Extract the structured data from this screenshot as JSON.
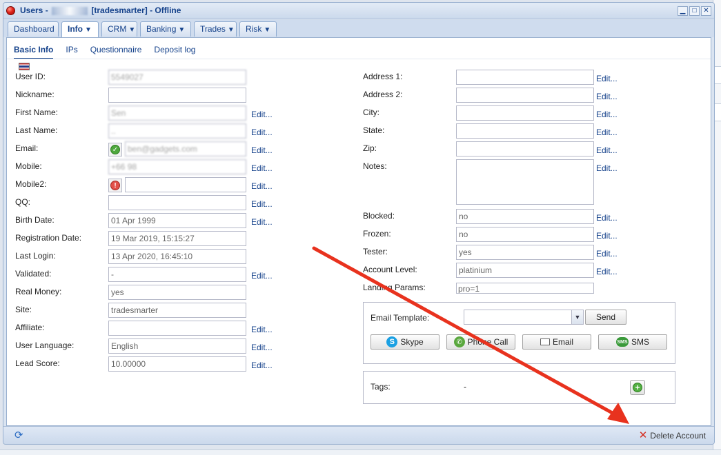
{
  "window": {
    "title_prefix": "Users - ",
    "title_suffix": "[tradesmarter] - Offline",
    "controls": [
      "minimize",
      "maximize",
      "close"
    ]
  },
  "main_tabs": [
    {
      "label": "Dashboard",
      "dropdown": false,
      "active": false
    },
    {
      "label": "Info",
      "dropdown": true,
      "active": true
    },
    {
      "label": "CRM",
      "dropdown": true,
      "active": false
    },
    {
      "label": "Banking",
      "dropdown": true,
      "active": false
    },
    {
      "label": "Trades",
      "dropdown": true,
      "active": false
    },
    {
      "label": "Risk",
      "dropdown": true,
      "active": false
    }
  ],
  "sub_tabs": [
    "Basic Info",
    "IPs",
    "Questionnaire",
    "Deposit log"
  ],
  "edit_label": "Edit...",
  "left_fields": [
    {
      "label": "User ID:",
      "value": "5549027",
      "obscured": true,
      "edit": false
    },
    {
      "label": "Nickname:",
      "value": "",
      "edit": false
    },
    {
      "label": "First Name:",
      "value": "Sen",
      "obscured": true,
      "edit": true
    },
    {
      "label": "Last Name:",
      "value": "..",
      "obscured": true,
      "edit": true
    },
    {
      "label": "Email:",
      "value": "ben@gadgets.com",
      "obscured": true,
      "edit": true,
      "status": "verified"
    },
    {
      "label": "Mobile:",
      "value": "+66 98",
      "obscured": true,
      "edit": true
    },
    {
      "label": "Mobile2:",
      "value": "",
      "edit": true,
      "status": "unverified"
    },
    {
      "label": "QQ:",
      "value": "",
      "edit": true
    },
    {
      "label": "Birth Date:",
      "value": "01 Apr 1999",
      "edit": true
    },
    {
      "label": "Registration Date:",
      "value": "19 Mar 2019, 15:15:27",
      "edit": false
    },
    {
      "label": "Last Login:",
      "value": "13 Apr 2020, 16:45:10",
      "edit": false
    },
    {
      "label": "Validated:",
      "value": "-",
      "edit": true
    },
    {
      "label": "Real Money:",
      "value": "yes",
      "edit": false
    },
    {
      "label": "Site:",
      "value": "tradesmarter",
      "edit": false
    },
    {
      "label": "Affiliate:",
      "value": "",
      "edit": true
    },
    {
      "label": "User Language:",
      "value": "English",
      "edit": true
    },
    {
      "label": "Lead Score:",
      "value": "10.00000",
      "edit": true
    }
  ],
  "right_fields": [
    {
      "label": "Address 1:",
      "value": "",
      "edit": true
    },
    {
      "label": "Address 2:",
      "value": "",
      "edit": true
    },
    {
      "label": "City:",
      "value": "",
      "edit": true
    },
    {
      "label": "State:",
      "value": "",
      "edit": true
    },
    {
      "label": "Zip:",
      "value": "",
      "edit": true
    },
    {
      "label": "Notes:",
      "value": "",
      "edit": true,
      "multiline": true
    },
    {
      "label": "Blocked:",
      "value": "no",
      "edit": true
    },
    {
      "label": "Frozen:",
      "value": "no",
      "edit": true
    },
    {
      "label": "Tester:",
      "value": "yes",
      "edit": true
    },
    {
      "label": "Account Level:",
      "value": "platinium",
      "edit": true
    },
    {
      "label": "Landing Params:",
      "value": "pro=1",
      "edit": false,
      "small": true
    }
  ],
  "contact_panel": {
    "email_template_label": "Email Template:",
    "email_template_value": "",
    "send_label": "Send",
    "actions": [
      {
        "label": "Skype",
        "icon": "skype-icon"
      },
      {
        "label": "Phone Call",
        "icon": "phone-icon"
      },
      {
        "label": "Email",
        "icon": "mail-icon"
      },
      {
        "label": "SMS",
        "icon": "sms-icon"
      }
    ]
  },
  "tags_panel": {
    "label": "Tags:",
    "value": "-"
  },
  "footer": {
    "delete_label": "Delete Account"
  },
  "colors": {
    "link": "#15428b",
    "annotation_arrow": "#e8321e",
    "title": "#15428b"
  }
}
